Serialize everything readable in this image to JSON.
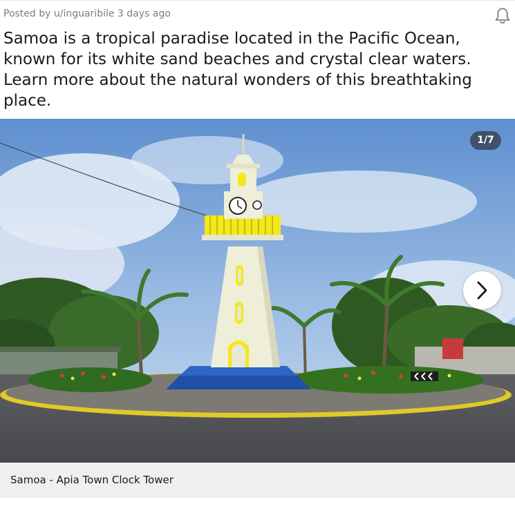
{
  "post": {
    "meta": "Posted by u/inguaribile 3 days ago",
    "title": "Samoa is a tropical paradise located in the Pacific Ocean, known for its white sand beaches and crystal clear waters. Learn more about the natural wonders of this breathtaking place."
  },
  "gallery": {
    "counter": "1/7",
    "caption": "Samoa - Apia Town Clock Tower",
    "image_subject": "Apia Town Clock Tower on a roundabout with palm trees under blue sky"
  },
  "icons": {
    "notify": "bell-icon",
    "next": "chevron-right-icon"
  },
  "colors": {
    "meta_text": "#7c7c7c",
    "caption_bg": "#edeff1",
    "tower_accent": "#f2e81c"
  }
}
